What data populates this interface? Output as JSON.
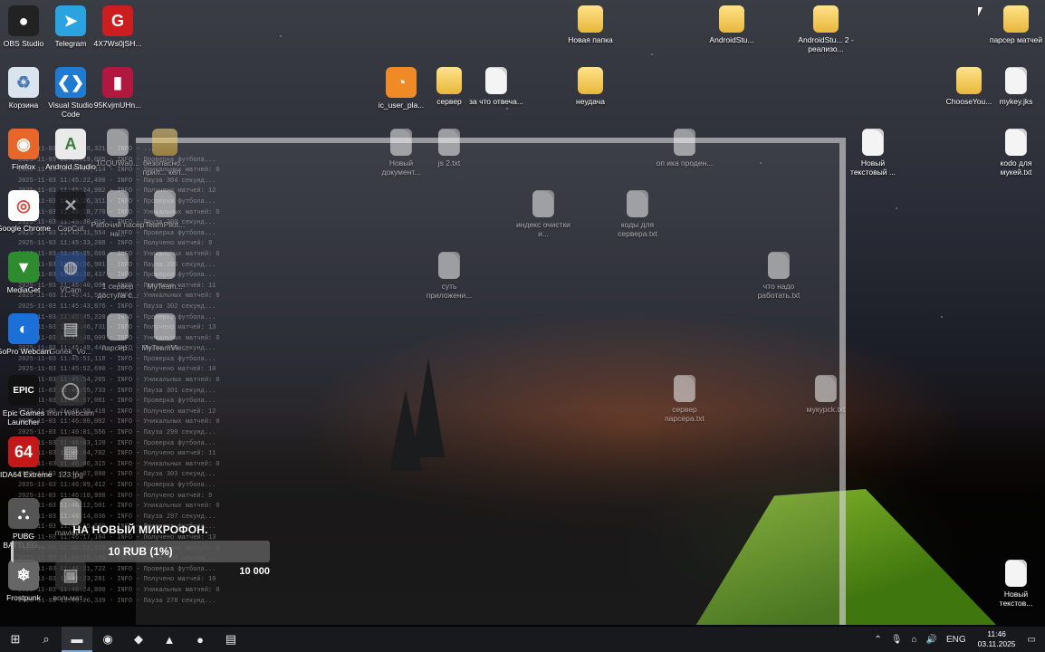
{
  "desktop_icons": [
    {
      "label": "OBS Studio",
      "icon": "obs-icon",
      "bg": "#222",
      "color": "#fff",
      "glyph": "●"
    },
    {
      "label": "Telegram",
      "icon": "telegram-icon",
      "bg": "#2aa3e0",
      "color": "#fff",
      "glyph": "➤"
    },
    {
      "label": "4X7Ws0jSH...",
      "icon": "app-icon",
      "bg": "#cc1e1e",
      "color": "#fff",
      "glyph": "G"
    },
    {
      "label": "Новая папка",
      "icon": "folder-icon",
      "kind": "folder"
    },
    {
      "label": "AndroidStu...",
      "icon": "folder-icon",
      "kind": "folder"
    },
    {
      "label": "AndroidStu... 2 - реализо...",
      "icon": "folder-icon",
      "kind": "folder"
    },
    {
      "label": "парсер матчей",
      "icon": "folder-icon",
      "kind": "folder"
    },
    {
      "label": "Корзина",
      "icon": "recycle-bin-icon",
      "bg": "#d9e4ee",
      "color": "#4a7ab0",
      "glyph": "♻"
    },
    {
      "label": "Visual Studio Code",
      "icon": "vscode-icon",
      "bg": "#1f7bd1",
      "color": "#fff",
      "glyph": "❮❯"
    },
    {
      "label": "95KvjmUHn...",
      "icon": "app-icon",
      "bg": "#b01840",
      "color": "#fff",
      "glyph": "▮"
    },
    {
      "label": "ic_user_pla...",
      "icon": "rss-icon",
      "bg": "#f08a24",
      "color": "#fff",
      "glyph": "◔"
    },
    {
      "label": "сервер",
      "icon": "folder-icon",
      "kind": "folder"
    },
    {
      "label": "за что отвеча...",
      "icon": "document-icon",
      "kind": "doc"
    },
    {
      "label": "неудача",
      "icon": "folder-icon",
      "kind": "folder"
    },
    {
      "label": "ChooseYou...",
      "icon": "folder-icon",
      "kind": "folder"
    },
    {
      "label": "mykey.jks",
      "icon": "document-icon",
      "kind": "doc"
    },
    {
      "label": "Firefox",
      "icon": "firefox-icon",
      "bg": "#e7662a",
      "color": "#fff",
      "glyph": "◉"
    },
    {
      "label": "Android Studio",
      "icon": "android-studio-icon",
      "bg": "#eaeaea",
      "color": "#3a7a3a",
      "glyph": "A"
    },
    {
      "label": "1CQUWa0...",
      "icon": "document-icon",
      "kind": "doc",
      "dim": true
    },
    {
      "label": "безопасно... прил... кел...",
      "icon": "folder-icon",
      "kind": "folder",
      "dim": true
    },
    {
      "label": "Новый документ...",
      "icon": "document-icon",
      "kind": "doc",
      "dim": true
    },
    {
      "label": "js 2.txt",
      "icon": "document-icon",
      "kind": "doc",
      "dim": true
    },
    {
      "label": "оп ика проден...",
      "icon": "document-icon",
      "kind": "doc",
      "dim": true
    },
    {
      "label": "Новый текстовый ...",
      "icon": "document-icon",
      "kind": "doc"
    },
    {
      "label": "коdo для мукей.txt",
      "icon": "document-icon",
      "kind": "doc"
    },
    {
      "label": "Google Chrome",
      "icon": "chrome-icon",
      "bg": "#fff",
      "color": "#db4437",
      "glyph": "◎"
    },
    {
      "label": "CapCut",
      "icon": "capcut-icon",
      "bg": "#111",
      "color": "#fff",
      "glyph": "✕",
      "dim": true
    },
    {
      "label": "Рабочий пасер на...",
      "icon": "document-icon",
      "kind": "doc",
      "dim": true
    },
    {
      "label": "TeamPilot...",
      "icon": "document-icon",
      "kind": "doc",
      "dim": true
    },
    {
      "label": "индекс очистки и...",
      "icon": "document-icon",
      "kind": "doc",
      "dim": true
    },
    {
      "label": "коды для сервера.txt",
      "icon": "document-icon",
      "kind": "doc",
      "dim": true
    },
    {
      "label": "MediaGet",
      "icon": "mediaget-icon",
      "bg": "#2e8b2e",
      "color": "#fff",
      "glyph": "▼"
    },
    {
      "label": "VCam",
      "icon": "vcam-icon",
      "bg": "#2a55a0",
      "color": "#fff",
      "glyph": "◍",
      "dim": true
    },
    {
      "label": "1 сервер доступа с...",
      "icon": "document-icon",
      "kind": "doc",
      "dim": true
    },
    {
      "label": "MyTeam...",
      "icon": "document-icon",
      "kind": "doc",
      "dim": true
    },
    {
      "label": "суть приложени...",
      "icon": "document-icon",
      "kind": "doc",
      "dim": true
    },
    {
      "label": "что надо работать.txt",
      "icon": "document-icon",
      "kind": "doc",
      "dim": true
    },
    {
      "label": "GoPro Webcam",
      "icon": "gopro-icon",
      "bg": "#1d6fd8",
      "color": "#fff",
      "glyph": "◐"
    },
    {
      "label": "Gonek_Vo...",
      "icon": "app-icon",
      "bg": "#333",
      "color": "#fff",
      "glyph": "▤",
      "dim": true
    },
    {
      "label": "парсер...",
      "icon": "document-icon",
      "kind": "doc",
      "dim": true
    },
    {
      "label": "MyTeamVie...",
      "icon": "document-icon",
      "kind": "doc",
      "dim": true
    },
    {
      "label": "Epic Games Launcher",
      "icon": "epic-games-icon",
      "bg": "#111",
      "color": "#fff",
      "glyph": "EPIC"
    },
    {
      "label": "Iriun Webcam",
      "icon": "iriun-icon",
      "bg": "#444",
      "color": "#fff",
      "glyph": "◯",
      "dim": true
    },
    {
      "label": "сервер парсера.txt",
      "icon": "document-icon",
      "kind": "doc",
      "dim": true
    },
    {
      "label": "мукурсk.txt",
      "icon": "document-icon",
      "kind": "doc",
      "dim": true
    },
    {
      "label": "AIDA64 Extreme",
      "icon": "aida64-icon",
      "bg": "#c41818",
      "color": "#fff",
      "glyph": "64"
    },
    {
      "label": "123.jpg",
      "icon": "image-icon",
      "bg": "#555",
      "color": "#fff",
      "glyph": "▦",
      "dim": true
    },
    {
      "label": "PUBG BATTLEG...",
      "icon": "pubg-icon",
      "bg": "#555",
      "color": "#fff",
      "glyph": "⛬"
    },
    {
      "label": "mavide...",
      "icon": "document-icon",
      "kind": "doc",
      "dim": true
    },
    {
      "label": "Frostpunk",
      "icon": "frostpunk-icon",
      "bg": "#666",
      "color": "#fff",
      "glyph": "❄"
    },
    {
      "label": "вольмат...",
      "icon": "app-icon",
      "bg": "#444",
      "color": "#fff",
      "glyph": "▣",
      "dim": true
    },
    {
      "label": "Новый текстов...",
      "icon": "document-icon",
      "kind": "doc"
    }
  ],
  "console_lines": [
    "2025-11-03 11:45:18,321 - INFO - ...",
    "2025-11-03 11:45:19,005 - INFO - Проверка футбола...",
    "2025-11-03 11:45:21,114 - INFO - Уникальных матчей: 0",
    "2025-11-03 11:45:22,480 - INFO - Пауза 304 секунд...",
    "2025-11-03 11:45:24,902 - INFO - Получено матчей: 12",
    "2025-11-03 11:45:26,311 - INFO - Проверка футбола...",
    "2025-11-03 11:45:28,770 - INFO - Уникальных матчей: 0",
    "2025-11-03 11:45:30,012 - INFO - Пауза 300 секунд...",
    "2025-11-03 11:45:31,554 - INFO - Проверка футбола...",
    "2025-11-03 11:45:33,208 - INFO - Получено матчей: 9",
    "2025-11-03 11:45:35,669 - INFO - Уникальных матчей: 0",
    "2025-11-03 11:45:36,901 - INFO - Пауза 296 секунд...",
    "2025-11-03 11:45:38,437 - INFO - Проверка футбола...",
    "2025-11-03 11:45:40,090 - INFO - Получено матчей: 11",
    "2025-11-03 11:45:41,512 - INFO - Уникальных матчей: 0",
    "2025-11-03 11:45:43,876 - INFO - Пауза 302 секунд...",
    "2025-11-03 11:45:45,220 - INFO - Проверка футбола...",
    "2025-11-03 11:45:46,731 - INFO - Получено матчей: 13",
    "2025-11-03 11:45:48,009 - INFO - Уникальных матчей: 0",
    "2025-11-03 11:45:49,442 - INFO - Пауза 298 секунд...",
    "2025-11-03 11:45:51,118 - INFO - Проверка футбола...",
    "2025-11-03 11:45:52,690 - INFO - Получено матчей: 10",
    "2025-11-03 11:45:54,205 - INFO - Уникальных матчей: 0",
    "2025-11-03 11:45:55,733 - INFO - Пауза 301 секунд...",
    "2025-11-03 11:45:57,061 - INFO - Проверка футбола...",
    "2025-11-03 11:45:58,418 - INFO - Получено матчей: 12",
    "2025-11-03 11:46:00,002 - INFO - Уникальных матчей: 0",
    "2025-11-03 11:46:01,556 - INFO - Пауза 299 секунд...",
    "2025-11-03 11:46:03,120 - INFO - Проверка футбола...",
    "2025-11-03 11:46:04,702 - INFO - Получено матчей: 11",
    "2025-11-03 11:46:06,315 - INFO - Уникальных матчей: 0",
    "2025-11-03 11:46:07,880 - INFO - Пауза 303 секунд...",
    "2025-11-03 11:46:09,412 - INFO - Проверка футбола...",
    "2025-11-03 11:46:10,998 - INFO - Получено матчей: 9",
    "2025-11-03 11:46:12,501 - INFO - Уникальных матчей: 0",
    "2025-11-03 11:46:14,036 - INFO - Пауза 297 секунд...",
    "2025-11-03 11:46:15,590 - INFO - Проверка футбола...",
    "2025-11-03 11:46:17,104 - INFO - Получено матчей: 13",
    "2025-11-03 11:46:18,655 - INFO - Уникальных матчей: 0",
    "2025-11-03 11:46:20,190 - INFO - Пауза 300 секунд...",
    "2025-11-03 11:46:21,722 - INFO - Проверка футбола...",
    "2025-11-03 11:46:23,281 - INFO - Получено матчей: 10",
    "2025-11-03 11:46:24,800 - INFO - Уникальных матчей: 0",
    "2025-11-03 11:46:26,339 - INFO - Пауза 278 секунд..."
  ],
  "donation": {
    "title": "НА НОВЫЙ МИКРОФОН.",
    "value_text": "10 RUB (1%)",
    "progress": 0.01,
    "goal": "10 000"
  },
  "taskbar": {
    "items": [
      {
        "name": "start-button",
        "glyph": "⊞"
      },
      {
        "name": "search-button",
        "glyph": "⌕"
      },
      {
        "name": "taskbar-file-explorer",
        "glyph": "▬",
        "active": true
      },
      {
        "name": "taskbar-firefox",
        "glyph": "◉"
      },
      {
        "name": "taskbar-android-studio",
        "glyph": "◆"
      },
      {
        "name": "taskbar-app",
        "glyph": "▲"
      },
      {
        "name": "taskbar-obs",
        "glyph": "●"
      },
      {
        "name": "taskbar-notepad",
        "glyph": "▤"
      }
    ],
    "tray": {
      "chevron": "⌃",
      "mic": "🎙",
      "volume": "🔊",
      "network": "⌂",
      "lang": "ENG",
      "time": "11:46",
      "date": "03.11.2025",
      "notifications": "▭"
    }
  }
}
